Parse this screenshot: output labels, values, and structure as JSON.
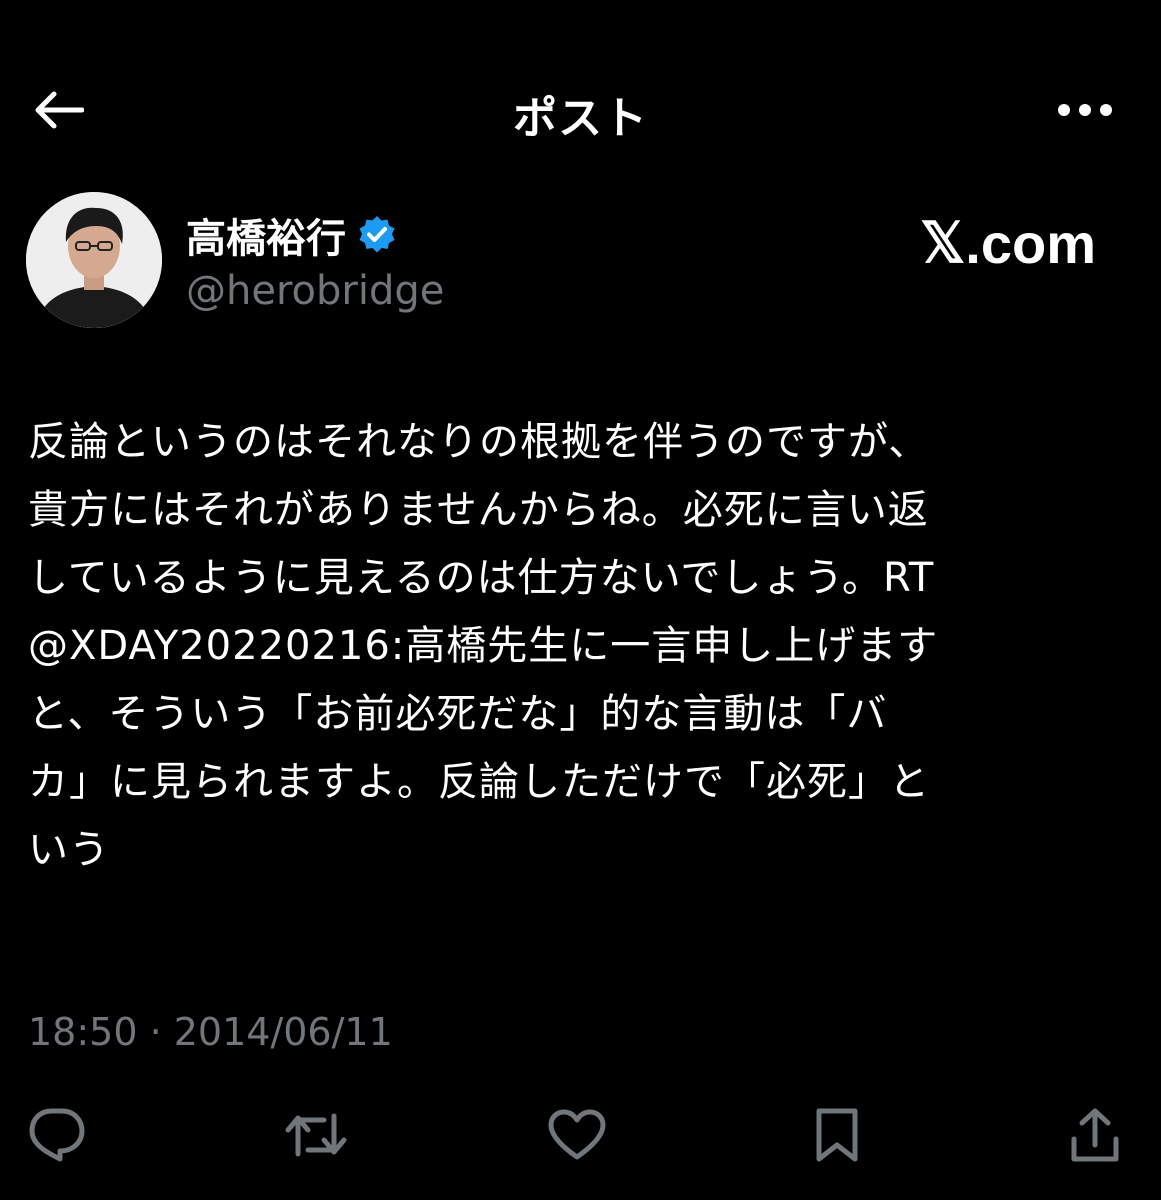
{
  "header": {
    "title": "ポスト",
    "back_icon": "arrow-left-icon",
    "more_icon": "more-horizontal-icon"
  },
  "author": {
    "name": "高橋裕行",
    "handle": "@herobridge",
    "verified_icon": "verified-badge-icon",
    "verified_color": "#1d9bf0"
  },
  "brand": {
    "x_mark": "𝕏",
    "suffix": ".com"
  },
  "tweet": {
    "text": "反論というのはそれなりの根拠を伴うのですが、\n貴方にはそれがありませんからね。必死に言い返\nしているように見えるのは仕方ないでしょう。RT\n@XDAY20220216:高橋先生に一言申し上げます\nと、そういう「お前必死だな」的な言動は「バ\nカ」に見られますよ。反論しただけで「必死」と\nいう",
    "timestamp": "18:50 · 2014/06/11"
  },
  "actions": [
    {
      "icon": "reply-icon"
    },
    {
      "icon": "retweet-icon"
    },
    {
      "icon": "like-icon"
    },
    {
      "icon": "bookmark-icon"
    },
    {
      "icon": "share-icon"
    }
  ],
  "colors": {
    "background": "#000000",
    "text": "#ffffff",
    "muted": "#71767b"
  }
}
